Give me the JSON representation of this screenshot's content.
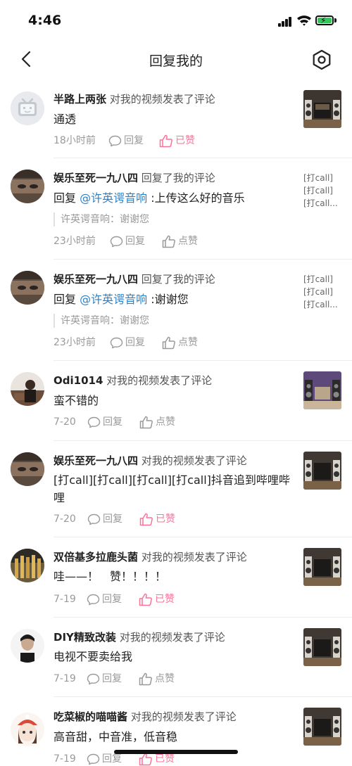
{
  "status_bar": {
    "time": "4:46"
  },
  "header": {
    "title": "回复我的"
  },
  "colors": {
    "accent_pink": "#fb7299",
    "mention_blue": "#2b81c9"
  },
  "items": [
    {
      "username": "半路上两张",
      "action": "对我的视频发表了评论",
      "content": "通透",
      "time": "18小时前",
      "reply": "回复",
      "like": "已赞",
      "liked": true,
      "avatar": "default-tv-avatar"
    },
    {
      "username": "娱乐至死一九八四",
      "action": "回复了我的评论",
      "content_prefix": "回复 ",
      "mention": "@许英谔音响",
      "content_suffix": " :上传这么好的音乐",
      "quote_text": "许英谔音响：谢谢您",
      "time": "23小时前",
      "reply": "回复",
      "like": "点赞",
      "liked": false,
      "tags": [
        "[打call]",
        "[打call]",
        "[打call..."
      ]
    },
    {
      "username": "娱乐至死一九八四",
      "action": "回复了我的评论",
      "content_prefix": "回复 ",
      "mention": "@许英谔音响",
      "content_suffix": " :谢谢您",
      "quote_text": "许英谔音响：谢谢您",
      "time": "23小时前",
      "reply": "回复",
      "like": "点赞",
      "liked": false,
      "tags": [
        "[打call]",
        "[打call]",
        "[打call..."
      ]
    },
    {
      "username": "Odi1014",
      "action": "对我的视频发表了评论",
      "content": "蛮不错的",
      "time": "7-20",
      "reply": "回复",
      "like": "点赞",
      "liked": false
    },
    {
      "username": "娱乐至死一九八四",
      "action": "对我的视频发表了评论",
      "content": "[打call][打call][打call][打call]抖音追到哔哩哔哩",
      "time": "7-20",
      "reply": "回复",
      "like": "已赞",
      "liked": true
    },
    {
      "username": "双倍基多拉鹿头菌",
      "action": "对我的视频发表了评论",
      "content": "哇——！　赞！！！！",
      "time": "7-19",
      "reply": "回复",
      "like": "已赞",
      "liked": true
    },
    {
      "username": "DIY精致改装",
      "action": "对我的视频发表了评论",
      "content": "电视不要卖给我",
      "time": "7-19",
      "reply": "回复",
      "like": "点赞",
      "liked": false
    },
    {
      "username": "吃菜椒的喵喵酱",
      "action": "对我的视频发表了评论",
      "content": "高音甜，中音准，低音稳",
      "time": "7-19",
      "reply": "回复",
      "like": "已赞",
      "liked": true
    }
  ]
}
